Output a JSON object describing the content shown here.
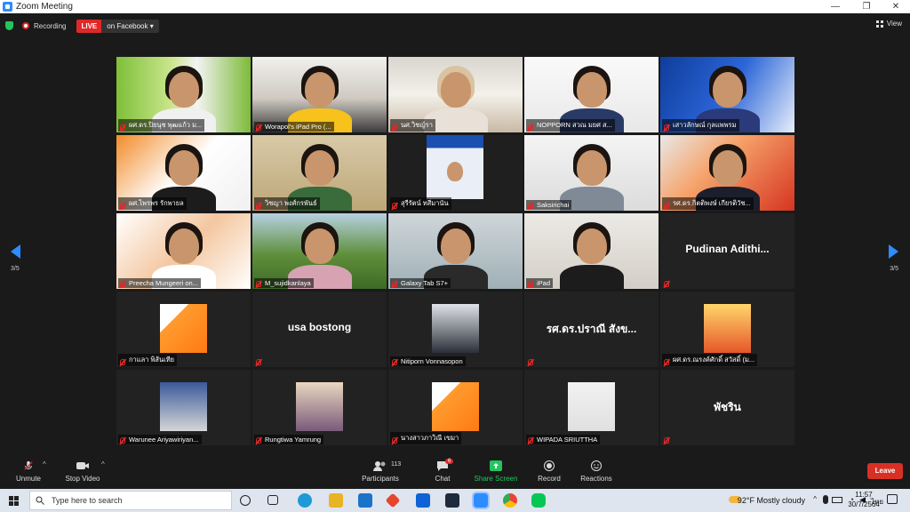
{
  "window": {
    "title": "Zoom Meeting",
    "minimize": "—",
    "maximize": "❐",
    "close": "✕"
  },
  "topbar": {
    "recording_label": "Recording",
    "live_label": "LIVE",
    "live_target": "on Facebook ▾",
    "view_label": "View"
  },
  "pager": {
    "left": "3/5",
    "right": "3/5"
  },
  "tiles": [
    {
      "name": "ผศ.ดร.ปิยนุช พุฒแก้ว ม..."
    },
    {
      "name": "Worapol's iPad Pro (..."
    },
    {
      "name": "นศ.วิชญ์รา"
    },
    {
      "name": "NOPPORN สวณ มยศ ส..."
    },
    {
      "name": "เสาวลักษณ์ กุลแพพรม"
    },
    {
      "name": "ผศ.ไพรพร รักพายล"
    },
    {
      "name": "วิชญา พงศ์กรพันธ์"
    },
    {
      "name": "สุรีรัตน์ ทสีมานัน"
    },
    {
      "name": "Saksirichai"
    },
    {
      "name": "รศ.ดร.กิตติพงษ์ เกียรติวัช..."
    },
    {
      "name": "Preecha Mungeeri on..."
    },
    {
      "name": "M_sujidkanlaya"
    },
    {
      "name": "Galaxy Tab S7+"
    },
    {
      "name": "iPad"
    },
    {
      "name": "",
      "big": "Pudinan  Adithi..."
    },
    {
      "name": "กาแลา พิส้นเทีย"
    },
    {
      "name": "",
      "big": "usa bostong"
    },
    {
      "name": "Nitiporn Vonnasopon"
    },
    {
      "name": "",
      "big": "รศ.ดร.ปราณี สังข..."
    },
    {
      "name": "ผศ.ดร.ณรงค์ศักดิ์ สวัสดิ์ (ม..."
    },
    {
      "name": "Warunee Ariyawiriyan..."
    },
    {
      "name": "Rungtiwa Yamrung"
    },
    {
      "name": "นางสาวภาวิณี เขมา"
    },
    {
      "name": "WIPADA SRIUTTHA"
    },
    {
      "name": "",
      "big": "พัชริน"
    }
  ],
  "toolbar": {
    "unmute": "Unmute",
    "stop_video": "Stop Video",
    "participants": "Participants",
    "participants_count": "113",
    "chat": "Chat",
    "chat_badge": "6",
    "share_screen": "Share Screen",
    "record": "Record",
    "reactions": "Reactions",
    "leave": "Leave"
  },
  "taskbar": {
    "search_placeholder": "Type here to search",
    "weather": "92°F  Mostly cloudy",
    "lang": "ไทย",
    "time": "11:57",
    "date": "30/7/2564"
  },
  "colors": {
    "accent": "#2d8cff",
    "live": "#e02828",
    "share": "#23c55e",
    "leave": "#d93025"
  }
}
